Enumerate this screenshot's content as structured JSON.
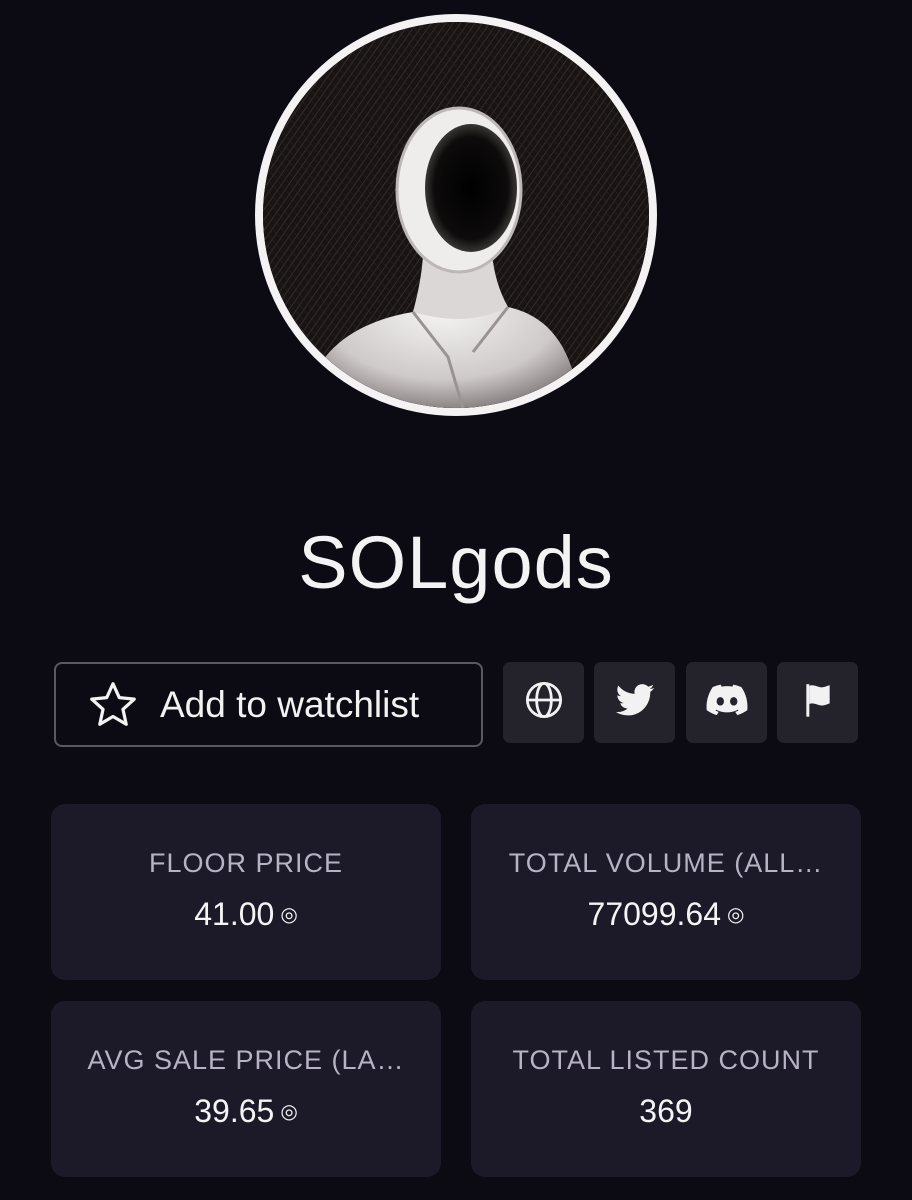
{
  "collection": {
    "name": "SOLgods"
  },
  "actions": {
    "watchlist_label": "Add to watchlist",
    "links": [
      {
        "icon": "globe-icon"
      },
      {
        "icon": "twitter-icon"
      },
      {
        "icon": "discord-icon"
      },
      {
        "icon": "flag-icon"
      }
    ]
  },
  "stats": {
    "floor_price": {
      "label": "FLOOR PRICE",
      "value": "41.00",
      "unit_symbol": "◎"
    },
    "total_volume": {
      "label": "TOTAL VOLUME (ALL…",
      "value": "77099.64",
      "unit_symbol": "◎"
    },
    "avg_sale_price": {
      "label": "AVG SALE PRICE (LA…",
      "value": "39.65",
      "unit_symbol": "◎"
    },
    "total_listed": {
      "label": "TOTAL LISTED COUNT",
      "value": "369"
    }
  },
  "colors": {
    "background": "#0c0a12",
    "card": "#1c1a29",
    "icon_button": "#24222b",
    "border": "#5a5863",
    "label_text": "#b7b2c4"
  }
}
